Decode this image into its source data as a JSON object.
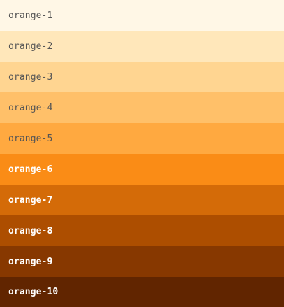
{
  "palette": {
    "swatches": [
      {
        "label": "orange-1",
        "color": "#fff7e6",
        "text_color": "#555555",
        "tone": "light"
      },
      {
        "label": "orange-2",
        "color": "#ffe7ba",
        "text_color": "#555555",
        "tone": "light"
      },
      {
        "label": "orange-3",
        "color": "#ffd591",
        "text_color": "#555555",
        "tone": "light"
      },
      {
        "label": "orange-4",
        "color": "#ffc069",
        "text_color": "#555555",
        "tone": "light"
      },
      {
        "label": "orange-5",
        "color": "#ffa940",
        "text_color": "#555555",
        "tone": "light"
      },
      {
        "label": "orange-6",
        "color": "#fa8c16",
        "text_color": "#ffffff",
        "tone": "dark"
      },
      {
        "label": "orange-7",
        "color": "#d46b08",
        "text_color": "#ffffff",
        "tone": "dark"
      },
      {
        "label": "orange-8",
        "color": "#ad4e00",
        "text_color": "#ffffff",
        "tone": "dark"
      },
      {
        "label": "orange-9",
        "color": "#873800",
        "text_color": "#ffffff",
        "tone": "dark"
      },
      {
        "label": "orange-10",
        "color": "#612500",
        "text_color": "#ffffff",
        "tone": "dark"
      }
    ]
  }
}
